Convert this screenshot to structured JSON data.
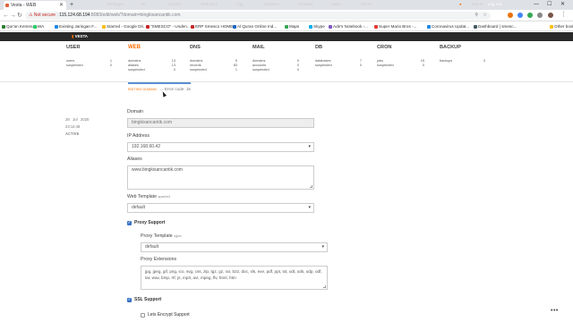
{
  "browser": {
    "tab_title": "Vesta - WEB",
    "url_warning": "Not secure",
    "url_host": "115.124.68.194",
    "url_path": ":8083/edit/web/?domain=bingkisancantik.com",
    "bookmarks": [
      {
        "label": "Qur'an Kemenag",
        "color": "#2e7d32"
      },
      {
        "label": "WA",
        "color": "#25d366"
      },
      {
        "label": "Existing Jaringan F...",
        "color": "#1e88e5"
      },
      {
        "label": "Starred - Google Dri...",
        "color": "#fbbc04"
      },
      {
        "label": "\"SMESCO\" - Unden...",
        "color": "#c62828"
      },
      {
        "label": "ERP Smesco HOME",
        "color": "#c62828"
      },
      {
        "label": "Al Quran Online Ind...",
        "color": "#1565c0"
      },
      {
        "label": "Maps",
        "color": "#34a853"
      },
      {
        "label": "Skype",
        "color": "#00aff0"
      },
      {
        "label": "Ade's Notebook -...",
        "color": "#7e57c2"
      },
      {
        "label": "Super Mario Bros -...",
        "color": "#e53935"
      },
      {
        "label": "Coronavirus Updat...",
        "color": "#1e88e5"
      },
      {
        "label": "Dashboard | smesc...",
        "color": "#455a64"
      },
      {
        "label": "Other bookmarks",
        "color": "#fbbc04"
      }
    ]
  },
  "app": {
    "logo": "VESTA",
    "nav": [
      "Packages",
      "IP",
      "Graphs",
      "Statistics",
      "Log",
      "Updates",
      "Firewall",
      "Apps",
      "Server"
    ],
    "user": "admin",
    "logout": "Log out"
  },
  "stats": {
    "columns": [
      {
        "title": "USER",
        "rows": [
          {
            "k": "users",
            "v": "1"
          },
          {
            "k": "suspended",
            "v": "0"
          }
        ]
      },
      {
        "title": "WEB",
        "rows": [
          {
            "k": "domains",
            "v": "13"
          },
          {
            "k": "aliases",
            "v": "13"
          },
          {
            "k": "suspended",
            "v": "0"
          }
        ]
      },
      {
        "title": "DNS",
        "rows": [
          {
            "k": "domains",
            "v": "5"
          },
          {
            "k": "records",
            "v": "83"
          },
          {
            "k": "suspended",
            "v": "1"
          }
        ]
      },
      {
        "title": "MAIL",
        "rows": [
          {
            "k": "domains",
            "v": "0"
          },
          {
            "k": "accounts",
            "v": "0"
          },
          {
            "k": "suspended",
            "v": "0"
          }
        ]
      },
      {
        "title": "DB",
        "rows": [
          {
            "k": "databases",
            "v": "7"
          },
          {
            "k": "suspended",
            "v": "0"
          }
        ]
      },
      {
        "title": "CRON",
        "rows": [
          {
            "k": "jobs",
            "v": "15"
          },
          {
            "k": "suspended",
            "v": "0"
          }
        ]
      },
      {
        "title": "BACKUP",
        "rows": [
          {
            "k": "backups",
            "v": "3"
          }
        ]
      }
    ]
  },
  "breadcrumb": {
    "current": "EDITING DOMAIN",
    "error": "Error code: 15"
  },
  "meta": {
    "date_day": "28",
    "date_month": "Jul",
    "date_year": "2020",
    "time": "23:14:48",
    "status": "ACTIVE"
  },
  "form": {
    "domain_label": "Domain",
    "domain_value": "bingkisancantik.com",
    "ip_label": "IP Address",
    "ip_value": "192.168.60.42",
    "aliases_label": "Aliases",
    "aliases_value": "www.bingkisancantik.com",
    "web_template_label": "Web Template",
    "web_template_hint": "apache2",
    "web_template_value": "default",
    "proxy_support_label": "Proxy Support",
    "proxy_support_checked": true,
    "proxy_template_label": "Proxy Template",
    "proxy_template_hint": "nginx",
    "proxy_template_value": "default",
    "proxy_ext_label": "Proxy Extensions",
    "proxy_ext_value": "jpg, jpeg, gif, png, ico, svg, css, zip, tgz, gz, rar, bz2, doc, xls, exe, pdf, ppt, txt, odt, ods, odp, odf, tar, wav, bmp, rtf, js, mp3, avi, mpeg, flv, html, htm",
    "ssl_support_label": "SSL Support",
    "ssl_support_checked": true,
    "lets_encrypt_label": "Lets Encrypt Support",
    "lets_encrypt_checked": false
  }
}
